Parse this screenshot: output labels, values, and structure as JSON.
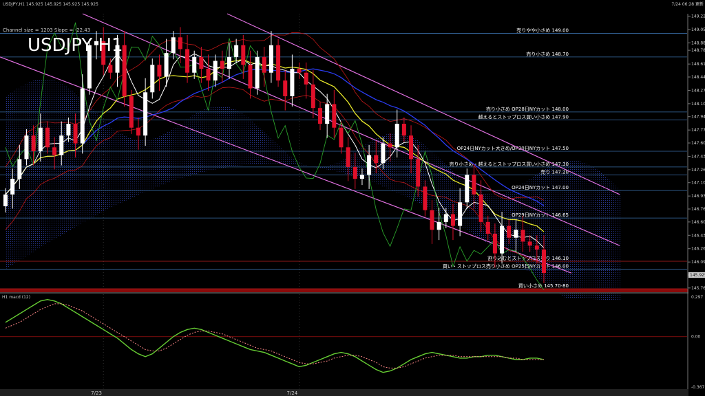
{
  "header": {
    "symbol_line": "USDJPY,H1  145.925 145.925 145.925 145.925",
    "big_title": "USDJPY H1",
    "channel_info": "Channel size = 1203 Slope = -22.43",
    "datetime_label": "7/24 06:28 更新"
  },
  "colors": {
    "background": "#000000",
    "candle_up": "#ffffff",
    "candle_down": "#e0102a",
    "sma_fast": "#ffffff",
    "sma_mid": "#e6e62a",
    "sma_slow": "#2a3cf0",
    "bollinger": "#c01818",
    "chikou": "#2aa02a",
    "span_line": "#c8b400",
    "channel": "#e070e0",
    "level_line": "#3a6ea8",
    "macd_line": "#66cc33",
    "signal_line": "#ff8888"
  },
  "chart_data": [
    {
      "type": "candlestick",
      "title": "USDJPY H1",
      "ylim": [
        145.75,
        149.25
      ],
      "y_ticks": [
        "149.220",
        "149.050",
        "148.880",
        "148.785",
        "148.610",
        "148.445",
        "148.275",
        "148.105",
        "147.940",
        "147.770",
        "147.605",
        "147.435",
        "147.265",
        "147.100",
        "146.930",
        "146.765",
        "146.600",
        "146.430",
        "146.260",
        "146.090",
        "145.925",
        "145.760"
      ],
      "x_labels": [
        "7/23",
        "7/24"
      ],
      "last_price": "145.925",
      "levels": [
        {
          "value": 149.0,
          "label": "売りやや小さめ 149.00",
          "color": "#3a6ea8"
        },
        {
          "value": 148.7,
          "label": "売り小さめ 148.70",
          "color": "#3a6ea8"
        },
        {
          "value": 148.0,
          "label": "売り小さめ OP28日NYカット 148.00",
          "color": "#3a6ea8"
        },
        {
          "value": 147.9,
          "label": "越えるとストップロス買い小さめ 147.90",
          "color": "#3a6ea8"
        },
        {
          "value": 147.5,
          "label": "OP24日NYカット大きめ/OP30日NYカット 147.50",
          "color": "#3a6ea8"
        },
        {
          "value": 147.3,
          "label": "売り小さめ・越えるとストップロス買い小さめ 147.30",
          "color": "#3a6ea8"
        },
        {
          "value": 147.2,
          "label": "売り 147.20",
          "color": "#3a6ea8"
        },
        {
          "value": 147.0,
          "label": "OP24日NYカット 147.00",
          "color": "#3a6ea8"
        },
        {
          "value": 146.65,
          "label": "OP29日NYカット 146.65",
          "color": "#3a6ea8"
        },
        {
          "value": 146.1,
          "label": "割り込むとストップロス売り 146.10",
          "color": "#c02020"
        },
        {
          "value": 146.0,
          "label": "買い・ストップロス売り小さめ OP25日NYカット 146.00",
          "color": "#3a6ea8"
        },
        {
          "value": 145.75,
          "label": "買い小さめ 145.70-80",
          "color": "#c02020"
        }
      ],
      "series": [
        {
          "name": "close",
          "values": [
            146.95,
            147.15,
            147.4,
            147.7,
            147.5,
            147.8,
            147.55,
            147.45,
            147.7,
            147.85,
            147.6,
            148.3,
            148.85,
            148.9,
            148.6,
            148.5,
            148.85,
            148.2,
            147.8,
            147.7,
            148.25,
            148.6,
            148.45,
            148.75,
            148.95,
            148.8,
            148.5,
            148.7,
            148.55,
            148.4,
            148.65,
            148.55,
            148.7,
            148.85,
            148.6,
            148.3,
            148.7,
            148.5,
            148.85,
            148.4,
            148.2,
            148.55,
            148.5,
            148.35,
            148.05,
            147.85,
            148.1,
            147.8,
            147.55,
            147.3,
            147.15,
            147.2,
            147.45,
            147.35,
            147.6,
            147.55,
            147.85,
            147.7,
            147.4,
            147.05,
            146.75,
            146.5,
            146.6,
            146.7,
            146.55,
            146.85,
            147.2,
            146.95,
            146.6,
            146.45,
            146.2,
            146.55,
            146.4,
            146.5,
            146.35,
            146.3,
            146.25,
            145.95
          ]
        },
        {
          "name": "open",
          "values": [
            146.8,
            146.95,
            147.15,
            147.4,
            147.7,
            147.5,
            147.8,
            147.55,
            147.45,
            147.7,
            147.85,
            147.6,
            148.3,
            148.85,
            148.9,
            148.6,
            148.5,
            148.85,
            148.2,
            147.8,
            147.7,
            148.25,
            148.6,
            148.45,
            148.75,
            148.95,
            148.8,
            148.5,
            148.7,
            148.55,
            148.4,
            148.65,
            148.55,
            148.7,
            148.85,
            148.6,
            148.3,
            148.7,
            148.5,
            148.85,
            148.4,
            148.2,
            148.55,
            148.5,
            148.35,
            148.05,
            147.85,
            148.1,
            147.8,
            147.55,
            147.3,
            147.15,
            147.2,
            147.45,
            147.35,
            147.6,
            147.55,
            147.85,
            147.7,
            147.4,
            147.05,
            146.75,
            146.5,
            146.6,
            146.7,
            146.55,
            146.85,
            147.2,
            146.95,
            146.6,
            146.45,
            146.2,
            146.55,
            146.4,
            146.5,
            146.35,
            146.3,
            146.25
          ]
        }
      ]
    },
    {
      "type": "line",
      "title": "H1 macd (12)",
      "ylim": [
        -0.367,
        0.297
      ],
      "y_ticks": [
        "0.297",
        "0.00",
        "-0.367"
      ],
      "series": [
        {
          "name": "macd",
          "values": [
            0.1,
            0.13,
            0.16,
            0.19,
            0.22,
            0.25,
            0.26,
            0.25,
            0.23,
            0.2,
            0.17,
            0.14,
            0.11,
            0.08,
            0.05,
            0.02,
            -0.01,
            -0.05,
            -0.09,
            -0.12,
            -0.14,
            -0.12,
            -0.08,
            -0.04,
            0.0,
            0.03,
            0.05,
            0.06,
            0.05,
            0.03,
            0.01,
            -0.01,
            -0.03,
            -0.05,
            -0.07,
            -0.09,
            -0.1,
            -0.11,
            -0.13,
            -0.15,
            -0.17,
            -0.19,
            -0.21,
            -0.2,
            -0.18,
            -0.16,
            -0.14,
            -0.12,
            -0.11,
            -0.12,
            -0.14,
            -0.17,
            -0.2,
            -0.23,
            -0.25,
            -0.24,
            -0.22,
            -0.19,
            -0.16,
            -0.14,
            -0.12,
            -0.11,
            -0.12,
            -0.13,
            -0.14,
            -0.15,
            -0.15,
            -0.14,
            -0.14,
            -0.13,
            -0.13,
            -0.14,
            -0.15,
            -0.16,
            -0.16,
            -0.15,
            -0.15,
            -0.16
          ]
        },
        {
          "name": "signal",
          "values": [
            0.06,
            0.08,
            0.1,
            0.13,
            0.16,
            0.19,
            0.21,
            0.23,
            0.23,
            0.22,
            0.2,
            0.18,
            0.15,
            0.12,
            0.09,
            0.06,
            0.03,
            0.0,
            -0.03,
            -0.06,
            -0.09,
            -0.1,
            -0.1,
            -0.08,
            -0.05,
            -0.02,
            0.01,
            0.03,
            0.04,
            0.04,
            0.03,
            0.02,
            0.0,
            -0.02,
            -0.04,
            -0.06,
            -0.08,
            -0.09,
            -0.1,
            -0.12,
            -0.14,
            -0.16,
            -0.18,
            -0.19,
            -0.19,
            -0.18,
            -0.17,
            -0.15,
            -0.14,
            -0.13,
            -0.13,
            -0.14,
            -0.16,
            -0.18,
            -0.21,
            -0.22,
            -0.22,
            -0.21,
            -0.19,
            -0.17,
            -0.15,
            -0.14,
            -0.13,
            -0.13,
            -0.13,
            -0.14,
            -0.14,
            -0.14,
            -0.14,
            -0.14,
            -0.14,
            -0.14,
            -0.15,
            -0.15,
            -0.16,
            -0.16,
            -0.16,
            -0.16
          ]
        }
      ]
    }
  ]
}
